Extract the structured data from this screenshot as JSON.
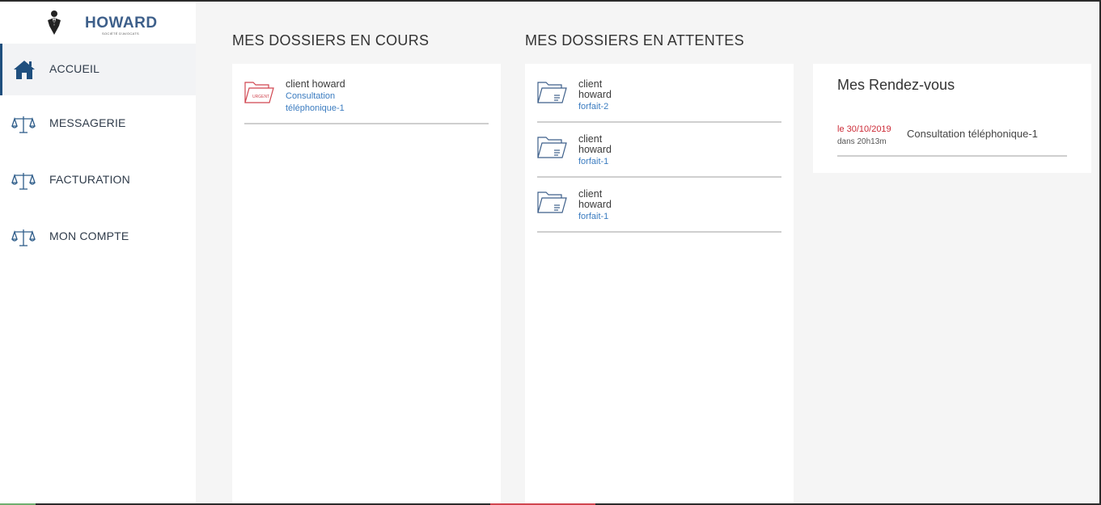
{
  "brand": {
    "name": "HOWARD",
    "subtitle": "SOCIÉTÉ D'AVOCATS"
  },
  "sidebar": {
    "items": [
      {
        "label": "ACCUEIL",
        "icon": "home-icon",
        "active": true
      },
      {
        "label": "MESSAGERIE",
        "icon": "scales-icon",
        "active": false
      },
      {
        "label": "FACTURATION",
        "icon": "scales-icon",
        "active": false
      },
      {
        "label": "MON COMPTE",
        "icon": "scales-icon",
        "active": false
      }
    ]
  },
  "en_cours": {
    "title": "MES DOSSIERS EN COURS",
    "items": [
      {
        "name": "client howard",
        "sub1": "Consultation",
        "sub2": "téléphonique-1",
        "badge": "URGENT"
      }
    ]
  },
  "en_attentes": {
    "title": "MES DOSSIERS EN ATTENTES",
    "items": [
      {
        "name1": "client",
        "name2": "howard",
        "sub": "forfait-2"
      },
      {
        "name1": "client",
        "name2": "howard",
        "sub": "forfait-1"
      },
      {
        "name1": "client",
        "name2": "howard",
        "sub": "forfait-1"
      }
    ]
  },
  "rendez_vous": {
    "title": "Mes Rendez-vous",
    "items": [
      {
        "date": "le 30/10/2019",
        "countdown": "dans 20h13m",
        "label": "Consultation téléphonique-1"
      }
    ]
  },
  "colors": {
    "accent": "#1f4f7e",
    "link": "#3b7cc0",
    "urgent": "#cc2a36"
  }
}
